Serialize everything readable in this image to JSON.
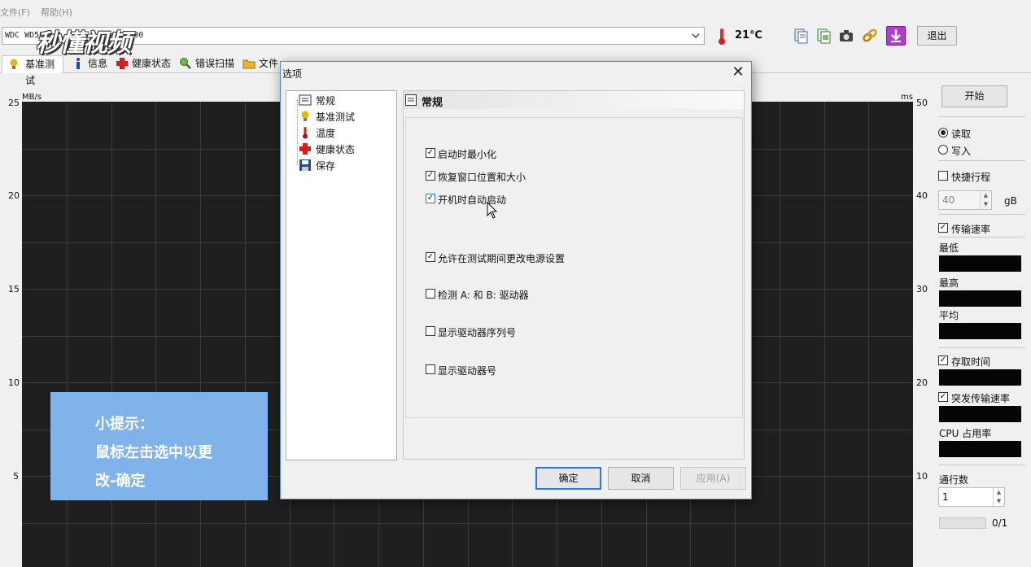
{
  "menu": {
    "file": "文件(F)",
    "help": "帮助(H)"
  },
  "watermark": "秒懂视频",
  "toolbar": {
    "drive_value": "WDC WD50",
    "drive_value_suffix": "(500",
    "temperature": "21℃",
    "exit_label": "退出"
  },
  "tabs": [
    "基准测试",
    "信息",
    "健康状态",
    "错误扫描",
    "文件"
  ],
  "chart": {
    "left_unit": "MB/s",
    "right_unit": "ms",
    "left_ticks": [
      "25",
      "20",
      "15",
      "10",
      "5"
    ],
    "right_ticks": [
      "50",
      "40",
      "30",
      "20",
      "10"
    ]
  },
  "tip": {
    "line1": "小提示：",
    "line2": "鼠标左击选中以更",
    "line3": "改-确定"
  },
  "right_panel": {
    "start_label": "开始",
    "read_label": "读取",
    "write_label": "写入",
    "shortstroke_label": "快捷行程",
    "shortstroke_value": "40",
    "shortstroke_unit": "gB",
    "transfer_rate_label": "传输速率",
    "min_label": "最低",
    "max_label": "最高",
    "avg_label": "平均",
    "access_time_label": "存取时间",
    "burst_rate_label": "突发传输速率",
    "cpu_label": "CPU 占用率",
    "passes_label": "通行数",
    "passes_value": "1",
    "progress_text": "0/1"
  },
  "dialog": {
    "title": "选项",
    "tree": [
      "常规",
      "基准测试",
      "温度",
      "健康状态",
      "保存"
    ],
    "section_title": "常规",
    "options": [
      {
        "label": "启动时最小化",
        "checked": true
      },
      {
        "label": "恢复窗口位置和大小",
        "checked": true
      },
      {
        "label": "开机时自动启动",
        "checked": true
      },
      {
        "label": "允许在测试期间更改电源设置",
        "checked": true
      },
      {
        "label": "检测 A: 和 B: 驱动器",
        "checked": false
      },
      {
        "label": "显示驱动器序列号",
        "checked": false
      },
      {
        "label": "显示驱动器号",
        "checked": false
      }
    ],
    "ok_label": "确定",
    "cancel_label": "取消",
    "apply_label": "应用(A)"
  }
}
